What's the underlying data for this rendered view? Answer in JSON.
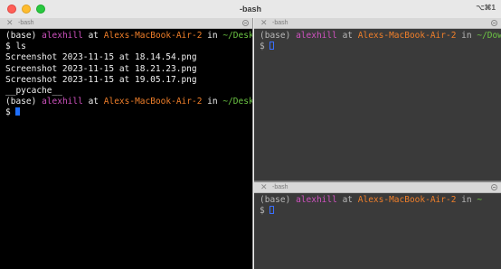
{
  "window": {
    "title": "-bash",
    "shortcut": "⌥⌘1"
  },
  "panes": {
    "left": {
      "tab_label": "-bash",
      "lines": [
        {
          "env": "(base)",
          "user": "alexhill",
          "at": "at",
          "host": "Alexs-MacBook-Air-2",
          "in": "in",
          "dir": "~/Desktop"
        },
        {
          "text": "$ ls"
        },
        {
          "text": "Screenshot 2023-11-15 at 18.14.54.png"
        },
        {
          "text": "Screenshot 2023-11-15 at 18.21.23.png"
        },
        {
          "text": "Screenshot 2023-11-15 at 19.05.17.png"
        },
        {
          "text": "__pycache__"
        },
        {
          "env": "(base)",
          "user": "alexhill",
          "at": "at",
          "host": "Alexs-MacBook-Air-2",
          "in": "in",
          "dir": "~/Desktop"
        },
        {
          "prompt": "$"
        }
      ]
    },
    "right_top": {
      "tab_label": "-bash",
      "lines": [
        {
          "env": "(base)",
          "user": "alexhill",
          "at": "at",
          "host": "Alexs-MacBook-Air-2",
          "in": "in",
          "dir": "~/Downloads"
        },
        {
          "prompt": "$"
        }
      ]
    },
    "right_bottom": {
      "tab_label": "-bash",
      "lines": [
        {
          "env": "(base)",
          "user": "alexhill",
          "at": "at",
          "host": "Alexs-MacBook-Air-2",
          "in": "in",
          "dir": "~"
        },
        {
          "prompt": "$"
        }
      ]
    }
  },
  "colors": {
    "user": "#d052c0",
    "host": "#f07f2a",
    "dir": "#6cc644",
    "cursor": "#1e6fff"
  }
}
